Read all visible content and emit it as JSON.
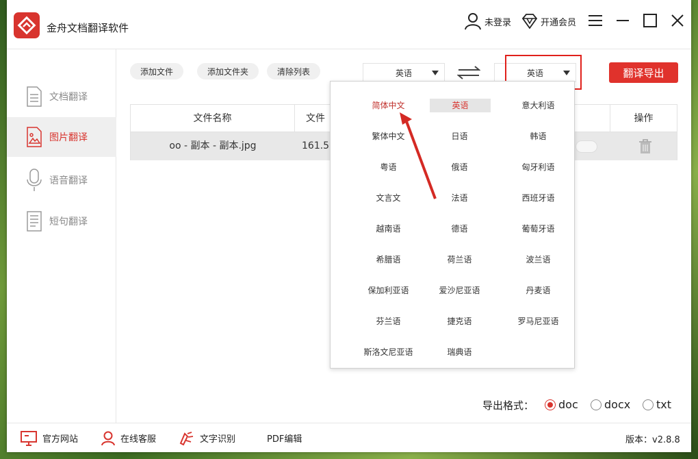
{
  "app": {
    "title": "金舟文档翻译软件"
  },
  "header": {
    "login_label": "未登录",
    "vip_label": "开通会员"
  },
  "sidebar": {
    "items": [
      {
        "label": "文档翻译",
        "active": false
      },
      {
        "label": "图片翻译",
        "active": true
      },
      {
        "label": "语音翻译",
        "active": false
      },
      {
        "label": "短句翻译",
        "active": false
      }
    ]
  },
  "toolbar": {
    "add_file": "添加文件",
    "add_folder": "添加文件夹",
    "clear_list": "清除列表",
    "source_lang": "英语",
    "target_lang": "英语",
    "translate_export": "翻译导出"
  },
  "table": {
    "headers": {
      "filename": "文件名称",
      "size": "文件",
      "action": "操作"
    },
    "rows": [
      {
        "filename": "oo - 副本 - 副本.jpg",
        "size": "161.5"
      }
    ]
  },
  "language_menu": {
    "options": [
      "简体中文",
      "英语",
      "意大利语",
      "繁体中文",
      "日语",
      "韩语",
      "粤语",
      "俄语",
      "匈牙利语",
      "文言文",
      "法语",
      "西班牙语",
      "越南语",
      "德语",
      "葡萄牙语",
      "希腊语",
      "荷兰语",
      "波兰语",
      "保加利亚语",
      "爱沙尼亚语",
      "丹麦语",
      "芬兰语",
      "捷克语",
      "罗马尼亚语",
      "斯洛文尼亚语",
      "瑞典语"
    ],
    "highlighted": "简体中文",
    "selected": "英语"
  },
  "export": {
    "label": "导出格式：",
    "options": [
      "doc",
      "docx",
      "txt"
    ],
    "selected": "doc"
  },
  "footer": {
    "website": "官方网站",
    "support": "在线客服",
    "ocr": "文字识别",
    "pdf_edit": "PDF编辑",
    "version": "版本：v2.8.8"
  },
  "colors": {
    "accent": "#d8342e",
    "highlight_box": "#e0201b"
  }
}
